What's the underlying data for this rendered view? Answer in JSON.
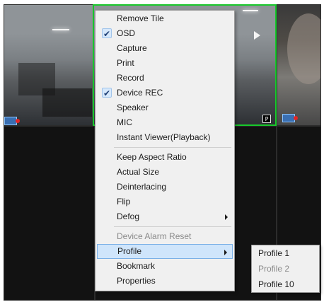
{
  "video_wall": {
    "p_badge": "P"
  },
  "context_menu": {
    "items": [
      {
        "label": "Remove Tile",
        "checked": false,
        "enabled": true,
        "submenu": false
      },
      {
        "label": "OSD",
        "checked": true,
        "enabled": true,
        "submenu": false
      },
      {
        "label": "Capture",
        "checked": false,
        "enabled": true,
        "submenu": false
      },
      {
        "label": "Print",
        "checked": false,
        "enabled": true,
        "submenu": false
      },
      {
        "label": "Record",
        "checked": false,
        "enabled": true,
        "submenu": false
      },
      {
        "label": "Device REC",
        "checked": true,
        "enabled": true,
        "submenu": false
      },
      {
        "label": "Speaker",
        "checked": false,
        "enabled": true,
        "submenu": false
      },
      {
        "label": "MIC",
        "checked": false,
        "enabled": true,
        "submenu": false
      },
      {
        "label": "Instant Viewer(Playback)",
        "checked": false,
        "enabled": true,
        "submenu": false
      },
      {
        "label": "Keep Aspect Ratio",
        "checked": false,
        "enabled": true,
        "submenu": false
      },
      {
        "label": "Actual Size",
        "checked": false,
        "enabled": true,
        "submenu": false
      },
      {
        "label": "Deinterlacing",
        "checked": false,
        "enabled": true,
        "submenu": false
      },
      {
        "label": "Flip",
        "checked": false,
        "enabled": true,
        "submenu": false
      },
      {
        "label": "Defog",
        "checked": false,
        "enabled": true,
        "submenu": true
      },
      {
        "label": "Device Alarm Reset",
        "checked": false,
        "enabled": false,
        "submenu": false
      },
      {
        "label": "Profile",
        "checked": false,
        "enabled": true,
        "submenu": true,
        "highlighted": true
      },
      {
        "label": "Bookmark",
        "checked": false,
        "enabled": true,
        "submenu": false
      },
      {
        "label": "Properties",
        "checked": false,
        "enabled": true,
        "submenu": false
      }
    ],
    "check_glyph": "✔"
  },
  "profile_submenu": {
    "items": [
      {
        "label": "Profile 1",
        "enabled": true
      },
      {
        "label": "Profile 2",
        "enabled": false
      },
      {
        "label": "Profile 10",
        "enabled": true
      }
    ]
  }
}
